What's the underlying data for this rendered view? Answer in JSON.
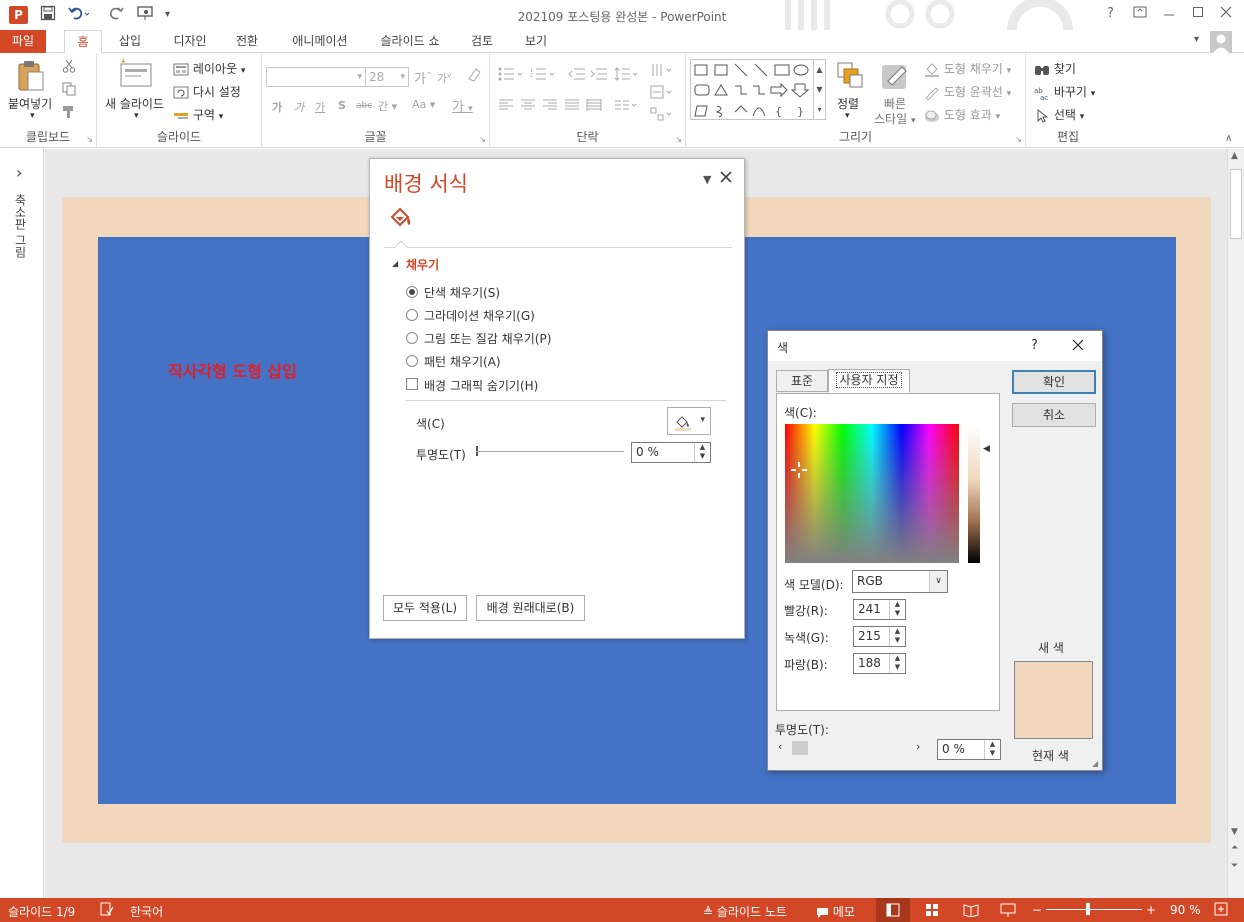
{
  "window": {
    "title": "202109 포스팅용 완성본 - PowerPoint",
    "help": "?",
    "app_logo": "P"
  },
  "tabs": [
    "파일",
    "홈",
    "삽입",
    "디자인",
    "전환",
    "애니메이션",
    "슬라이드 쇼",
    "검토",
    "보기"
  ],
  "ribbon": {
    "clipboard": {
      "label": "클립보드",
      "paste": "붙여넣기"
    },
    "slides": {
      "label": "슬라이드",
      "new_slide": "새 슬라이드",
      "layout": "레이아웃",
      "reset": "다시 설정",
      "section": "구역"
    },
    "font": {
      "label": "글꼴",
      "size": "28"
    },
    "paragraph": {
      "label": "단락"
    },
    "drawing": {
      "label": "그리기",
      "arrange": "정렬",
      "quick_style_1": "빠른",
      "quick_style_2": "스타일",
      "shape_fill": "도형 채우기",
      "shape_outline": "도형 윤곽선",
      "shape_effect": "도형 효과"
    },
    "editing": {
      "label": "편집",
      "find": "찾기",
      "replace": "바꾸기",
      "select": "선택"
    }
  },
  "left_panel": {
    "label": "축소판 그림",
    "expand": "›"
  },
  "slide": {
    "text": "직사각형 도형 삽입",
    "outer_color": "#f1d7bc",
    "inner_color": "#4472c4"
  },
  "format_pane": {
    "title": "배경 서식",
    "section": "채우기",
    "options": [
      {
        "label": "단색 채우기(S)",
        "selected": true
      },
      {
        "label": "그라데이션 채우기(G)",
        "selected": false
      },
      {
        "label": "그림 또는 질감 채우기(P)",
        "selected": false
      },
      {
        "label": "패턴 채우기(A)",
        "selected": false
      }
    ],
    "hide_graphics": "배경 그래픽 숨기기(H)",
    "color_label": "색(C)",
    "transparency_label": "투명도(T)",
    "transparency_value": "0 %",
    "apply_all": "모두 적용(L)",
    "reset_bg": "배경 원래대로(B)"
  },
  "color_dialog": {
    "title": "색",
    "help": "?",
    "tabs": [
      "표준",
      "사용자 지정"
    ],
    "colors_label": "색(C):",
    "model_label": "색 모델(D):",
    "model_value": "RGB",
    "red_label": "빨강(R):",
    "red": "241",
    "green_label": "녹색(G):",
    "green": "215",
    "blue_label": "파랑(B):",
    "blue": "188",
    "transparency_label": "투명도(T):",
    "transparency_value": "0 %",
    "ok": "확인",
    "cancel": "취소",
    "new_label": "새 색",
    "current_label": "현재 색",
    "new_color": "#f1d7bc"
  },
  "status": {
    "slide": "슬라이드 1/9",
    "language": "한국어",
    "notes": "슬라이드 노트",
    "comments": "메모",
    "zoom": "90 %"
  },
  "colors": {
    "accent": "#d24726",
    "slide_blue": "#4472c4",
    "peach": "#f1d7bc"
  }
}
